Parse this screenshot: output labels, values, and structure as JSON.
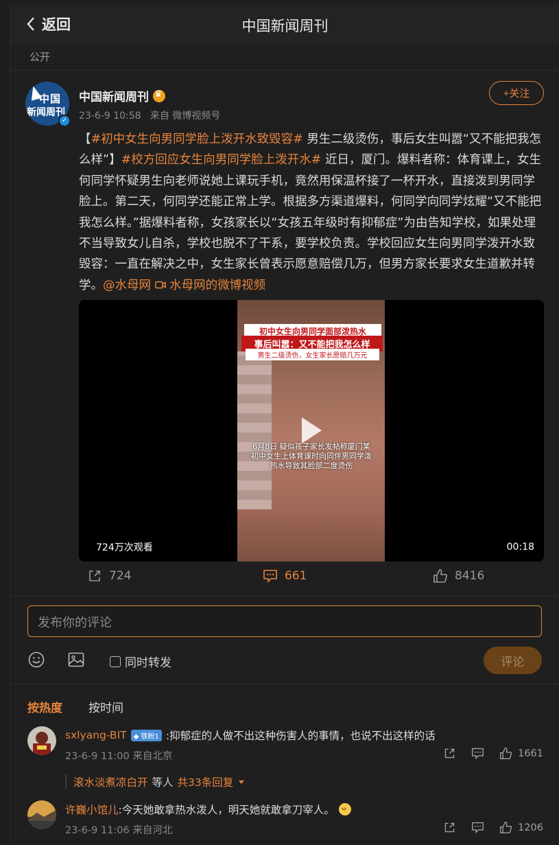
{
  "header": {
    "back_label": "返回",
    "title": "中国新闻周刊"
  },
  "visibility": "公开",
  "post": {
    "author": "中国新闻周刊",
    "avatar_text_1": "中国",
    "avatar_text_2": "新闻周刊",
    "time": "23-6-9 10:58",
    "source": "来自 微博视频号",
    "follow_label": "+关注",
    "text": {
      "b0": "【",
      "tag1": "#初中女生向男同学脸上泼开水致毁容#",
      "b1": " 男生二级烫伤，事后女生叫嚣“又不能把我怎么样”】",
      "tag2": "#校方回应女生向男同学脸上泼开水#",
      "b2": " 近日，厦门。爆料者称：体育课上，女生何同学怀疑男生向老师说她上课玩手机，竟然用保温杯接了一杯开水，直接泼到男同学脸上。第二天，何同学还能正常上学。根据多方渠道爆料，何同学向同学炫耀“又不能把我怎么样。”据爆料者称，女孩家长以“女孩五年级时有抑郁症”为由告知学校，如果处理不当导致女儿自杀，学校也脱不了干系，要学校负责。学校回应女生向男同学泼开水致毁容：一直在解决之中，女生家长曾表示愿意赔偿几万，但男方家长要求女生道歉并转学。",
      "mention": "@水母网",
      "video_link": "水母网的微博视频"
    },
    "video": {
      "headline1": "初中女生向男同学面部泼热水",
      "headline2": "事后叫嚣：又不能把我怎么样",
      "headline3": "男生二级烫伤，女生家长愿赔几万元",
      "caption": "6月8日 疑似孩子家长发帖称厦门某初中女生上体育课时向同伴男同学泼热水导致其脸部二度烫伤",
      "views": "724万次观看",
      "duration": "00:18"
    },
    "stats": {
      "reposts": "724",
      "comments": "661",
      "likes": "8416"
    }
  },
  "composer": {
    "placeholder": "发布你的评论",
    "repost_label": "同时转发",
    "submit_label": "评论"
  },
  "sort": {
    "hot": "按热度",
    "time": "按时间"
  },
  "comments": [
    {
      "name": "sxlyang-BIT",
      "badge": "铁粉1",
      "text": ":抑郁症的人做不出这种伤害人的事情，也说不出这样的话",
      "meta": "23-6-9 11:00 来自北京",
      "likes": "1661",
      "reply_user": "滚水淡煮凉白开",
      "reply_mid": " 等人 ",
      "reply_count": "共33条回复"
    },
    {
      "name": "许巍小馆儿",
      "text": ":今天她敢拿热水泼人，明天她就敢拿刀宰人。",
      "meta": "23-6-9 11:06 来自河北",
      "likes": "1206"
    }
  ],
  "colors": {
    "accent": "#e8843c",
    "background": "#1f1f1f"
  }
}
